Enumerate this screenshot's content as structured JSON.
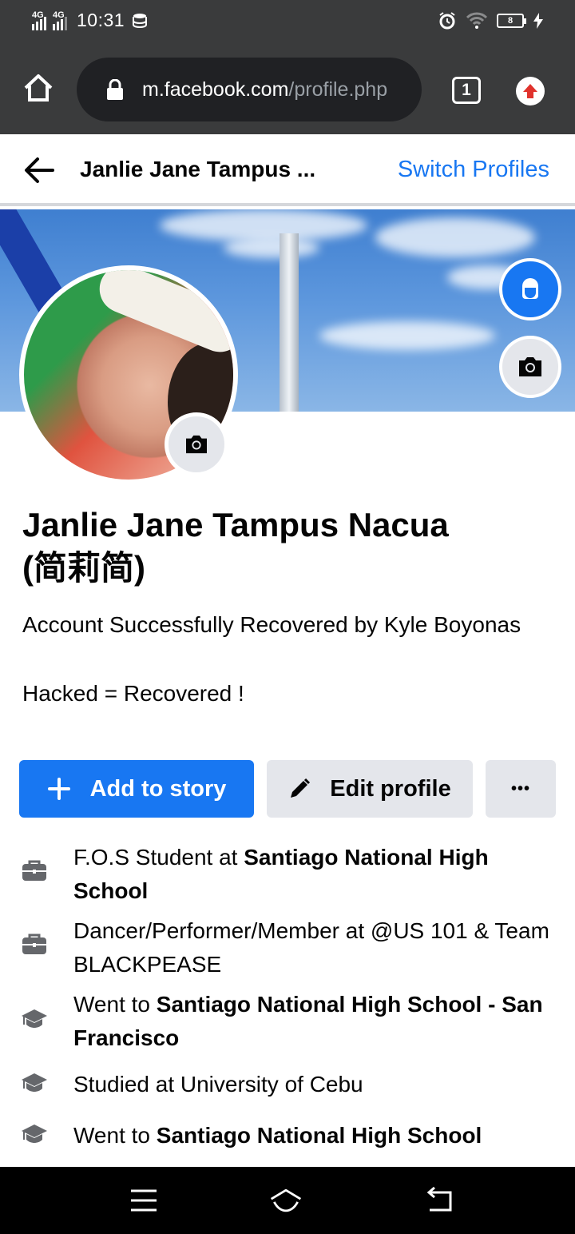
{
  "status_bar": {
    "network_1": "4G",
    "network_2": "4G",
    "time": "10:31",
    "battery": "8"
  },
  "browser": {
    "url_domain": "m.facebook.com",
    "url_path": "/profile.php",
    "tab_count": "1"
  },
  "header": {
    "title": "Janlie Jane Tampus ...",
    "switch_profiles": "Switch Profiles"
  },
  "profile": {
    "name_line1": "Janlie Jane Tampus Nacua",
    "name_line2": "(简莉简)",
    "bio": "Account Successfully Recovered by Kyle Boyonas\n\nHacked = Recovered !"
  },
  "actions": {
    "add_story": "Add to story",
    "edit_profile": "Edit profile",
    "more": "•••"
  },
  "info": [
    {
      "icon": "briefcase-icon",
      "prefix": "F.O.S Student at ",
      "bold": "Santiago National High School"
    },
    {
      "icon": "briefcase-icon",
      "prefix": "Dancer/Performer/Member at @US 101 & Team BLACKPEASE",
      "bold": ""
    },
    {
      "icon": "graduation-cap-icon",
      "prefix": "Went to ",
      "bold": "Santiago National High School - San Francisco"
    },
    {
      "icon": "graduation-cap-icon",
      "prefix": "Studied at University of Cebu",
      "bold": ""
    },
    {
      "icon": "graduation-cap-icon",
      "prefix": "Went to ",
      "bold": "Santiago National High School"
    }
  ],
  "colors": {
    "brand_blue": "#1877f2",
    "chrome_dark": "#3a3b3c",
    "button_grey": "#e4e6eb"
  }
}
